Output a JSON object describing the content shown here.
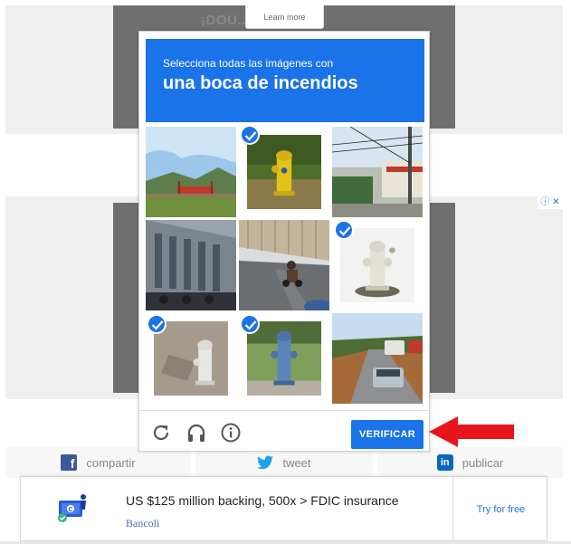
{
  "background": {
    "learn_more": "Learn more",
    "top_ad_text": "¡DOU...  ...IÓ!",
    "adchoices": "ⓘ ✕"
  },
  "captcha": {
    "instruction": "Selecciona todas las imágenes con",
    "target_object": "una boca de incendios",
    "tiles": [
      {
        "scene": "landscape with red bridge",
        "selected": false
      },
      {
        "scene": "yellow fire hydrant",
        "selected": true
      },
      {
        "scene": "street with power lines",
        "selected": false
      },
      {
        "scene": "building facade with bikes",
        "selected": false
      },
      {
        "scene": "road with motorcycle",
        "selected": false
      },
      {
        "scene": "white fire hydrant",
        "selected": true
      },
      {
        "scene": "white hydrant on pavement",
        "selected": true
      },
      {
        "scene": "blue fire hydrant",
        "selected": true
      },
      {
        "scene": "road with cars",
        "selected": false
      }
    ],
    "footer": {
      "reload_icon": "reload-icon",
      "audio_icon": "headphones-icon",
      "info_icon": "info-icon",
      "verify_label": "VERIFICAR"
    },
    "accent_color": "#1a73e8"
  },
  "share": {
    "facebook": "compartir",
    "twitter": "tweet",
    "linkedin": "publicar"
  },
  "bottom_ad": {
    "headline": "US $125 million backing, 500x > FDIC insurance",
    "brand": "Bancoli",
    "cta": "Try for free"
  },
  "annotation": {
    "arrow_color": "#e8141c"
  }
}
